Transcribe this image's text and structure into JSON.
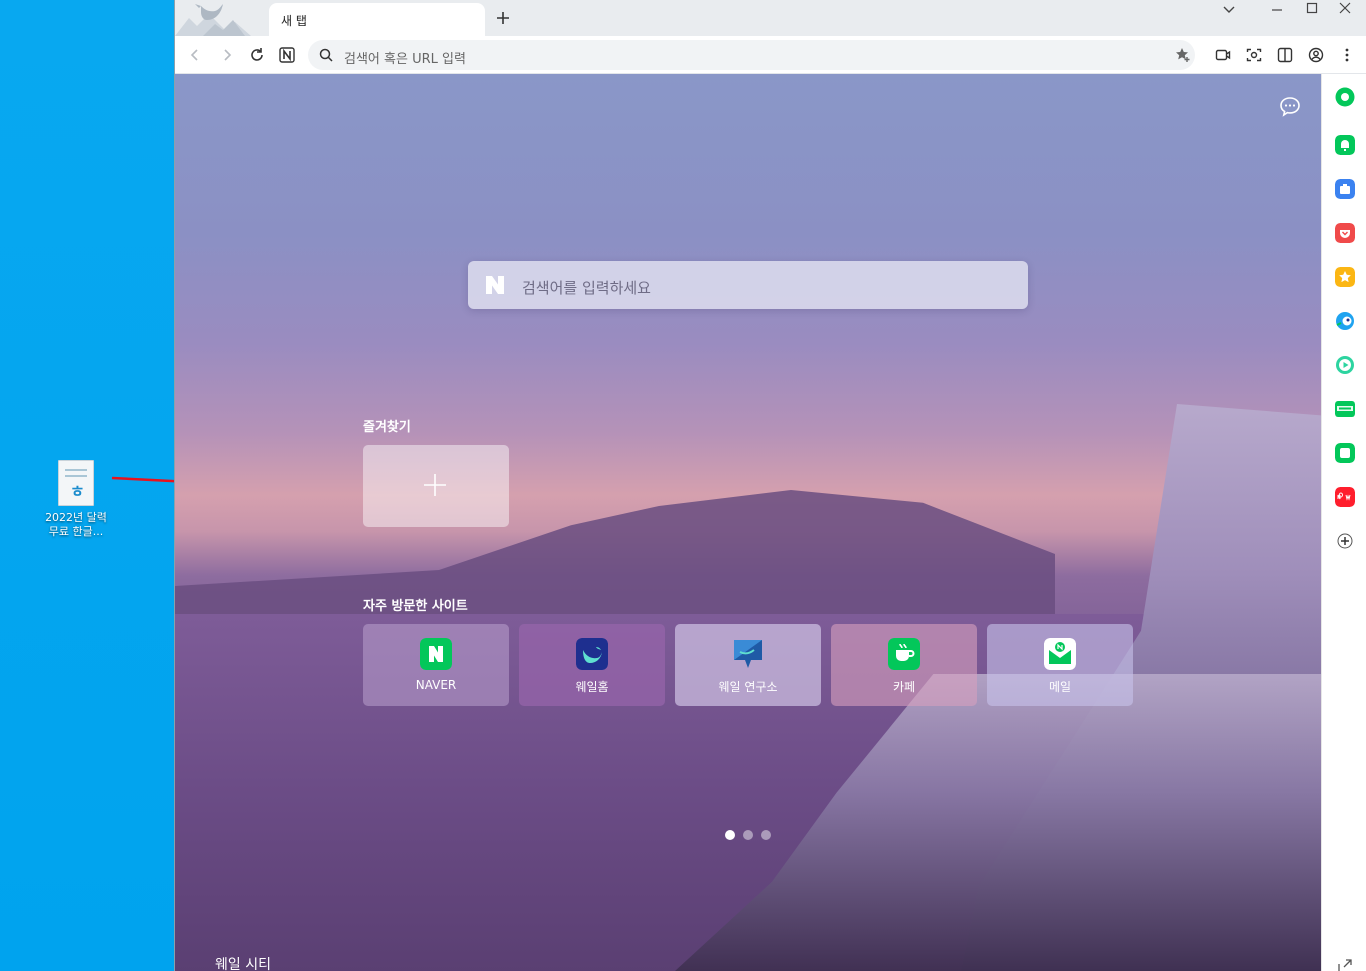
{
  "desktop": {
    "icon_label_line1": "2022년 달력",
    "icon_label_line2": "무료 한글..."
  },
  "browser": {
    "tab_title": "새 탭",
    "address_placeholder": "검색어 혹은 URL 입력"
  },
  "newtab": {
    "search_placeholder": "검색어를 입력하세요",
    "favorites_title": "즐겨찾기",
    "frequent_title": "자주 방문한 사이트",
    "sites": [
      {
        "label": "NAVER"
      },
      {
        "label": "웨일홈"
      },
      {
        "label": "웨일 연구소"
      },
      {
        "label": "카페"
      },
      {
        "label": "메일"
      }
    ],
    "bottom_label": "웨일 시티"
  },
  "colors": {
    "desktop_bg": "#00a3ee",
    "naver_green": "#03c75a",
    "whale_blue": "#2a3fb0",
    "arrow_red": "#e8131e"
  }
}
